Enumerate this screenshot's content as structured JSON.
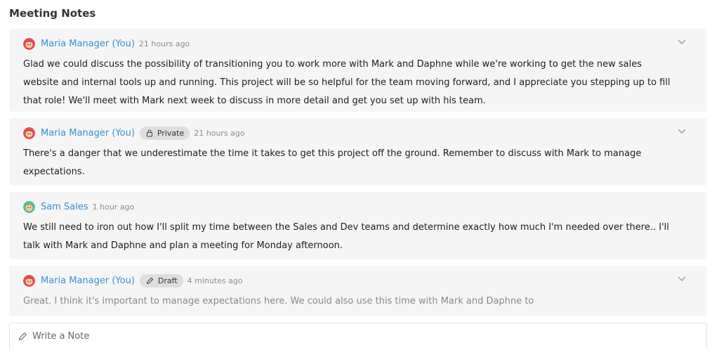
{
  "section": {
    "title": "Meeting Notes"
  },
  "notes": [
    {
      "author": "Maria Manager (You)",
      "avatar_icon": "maria-avatar",
      "badge": null,
      "time": "21 hours ago",
      "text": "Glad we could discuss the possibility of transitioning you to work more with Mark and Daphne while we're working to get the new sales website and internal tools up and running. This project will be so helpful for the team moving forward, and I appreciate you stepping up to fill that role! We'll meet with Mark next week to discuss in more detail and get you set up with his team."
    },
    {
      "author": "Maria Manager (You)",
      "avatar_icon": "maria-avatar",
      "badge": "Private",
      "badge_icon": "lock-icon",
      "time": "21 hours ago",
      "text": "There's a danger that we underestimate the time it takes to get this project off the ground. Remember to discuss with Mark to manage expectations."
    },
    {
      "author": "Sam Sales",
      "avatar_icon": "sam-avatar",
      "badge": null,
      "time": "1 hour ago",
      "text": "We still need to iron out how I'll split my time between the Sales and Dev teams and determine exactly how much I'm needed over there.. I'll talk with Mark and Daphne and plan a meeting for Monday afternoon."
    },
    {
      "author": "Maria Manager (You)",
      "avatar_icon": "maria-avatar",
      "badge": "Draft",
      "badge_icon": "pencil-icon",
      "time": "4 minutes ago",
      "text": "Great. I think it's important to manage expectations here. We could also use this time with Mark and Daphne to"
    }
  ],
  "composer": {
    "placeholder": "Write a Note",
    "icon": "pencil-icon"
  },
  "colors": {
    "author_link": "#3a8fd6",
    "note_background": "#f5f5f5",
    "badge_background": "#dedede",
    "timestamp": "#8c8c8c",
    "draft_text": "#8a8a8a"
  }
}
